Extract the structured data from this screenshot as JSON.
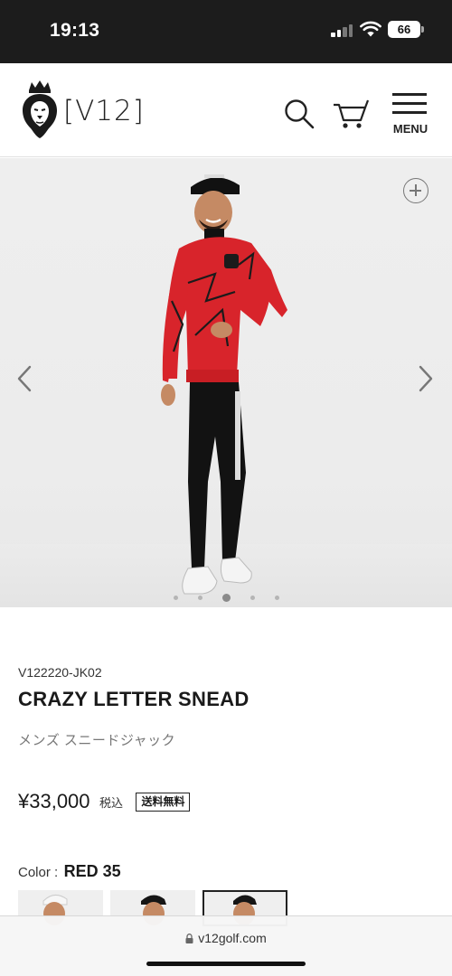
{
  "status_bar": {
    "time": "19:13",
    "battery": "66",
    "icons": [
      "cellular-signal-icon",
      "wifi-icon",
      "battery-icon"
    ]
  },
  "header": {
    "logo_text": "[V12]",
    "menu_label": "MENU",
    "icons": [
      "lion-logo-icon",
      "search-icon",
      "cart-icon",
      "hamburger-menu-icon"
    ]
  },
  "gallery": {
    "slide_count": 5,
    "active_slide": 3,
    "icons": [
      "zoom-plus-icon",
      "chevron-left-icon",
      "chevron-right-icon"
    ]
  },
  "product": {
    "sku": "V122220-JK02",
    "name": "CRAZY LETTER SNEAD",
    "subtitle": "メンズ スニードジャック",
    "price": "¥33,000",
    "tax_label": "税込",
    "shipping_badge": "送料無料",
    "color_label": "Color :",
    "color_value": "RED 35",
    "color_swatch_count": 3,
    "selected_swatch": 3
  },
  "browser": {
    "url": "v12golf.com",
    "icons": [
      "lock-icon"
    ]
  },
  "colors": {
    "status_bar_bg": "#1c1c1c",
    "sweater_red": "#d8242b",
    "text_primary": "#1a1a1a",
    "text_muted": "#777777"
  }
}
